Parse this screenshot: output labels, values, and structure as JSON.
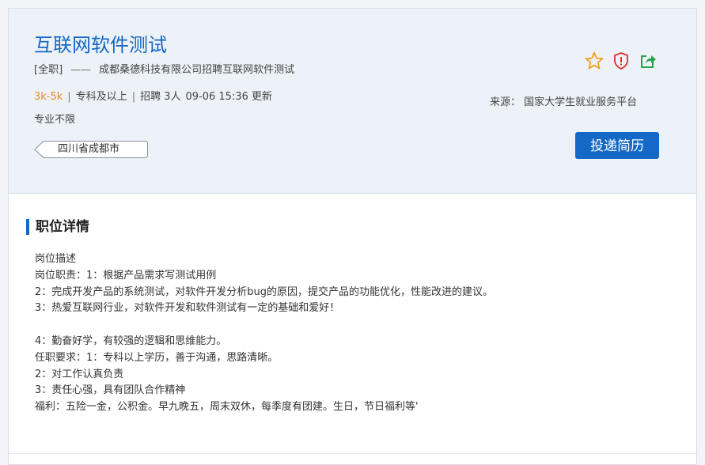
{
  "job": {
    "title": "互联网软件测试",
    "type": "[全职]",
    "dash": "——",
    "subtitle": "成都桑德科技有限公司招聘互联网软件测试",
    "salary": "3k-5k",
    "separator": "|",
    "education": "专科及以上",
    "headcount": "招聘 3人",
    "updated": "09-06 15:36 更新",
    "major": "专业不限",
    "location": "四川省成都市"
  },
  "actions": {
    "icons": [
      "star-icon",
      "shield-icon",
      "share-icon"
    ],
    "source": "来源： 国家大学生就业服务平台",
    "apply_label": "投递简历"
  },
  "details": {
    "heading": "职位详情",
    "lines": [
      "岗位描述",
      "岗位职责：1：根据产品需求写测试用例",
      "2：完成开发产品的系统测试，对软件开发分析bug的原因，提交产品的功能优化，性能改进的建议。",
      "3：热爱互联网行业，对软件开发和软件测试有一定的基础和爱好！",
      "",
      "4：勤奋好学，有较强的逻辑和思维能力。",
      "任职要求：1：专科以上学历，善于沟通，思路清晰。",
      "2：对工作认真负责",
      "3：责任心强，具有团队合作精神",
      "福利：五险一金，公积金。早九晚五，周末双休，每季度有团建。生日，节日福利等'"
    ]
  },
  "colors": {
    "accent": "#1468c6",
    "title": "#1366c6",
    "salary": "#f08a1c",
    "star": "#f0a020",
    "shield": "#e0302a",
    "share": "#2aa146",
    "header_bg": "#edf2f8"
  }
}
